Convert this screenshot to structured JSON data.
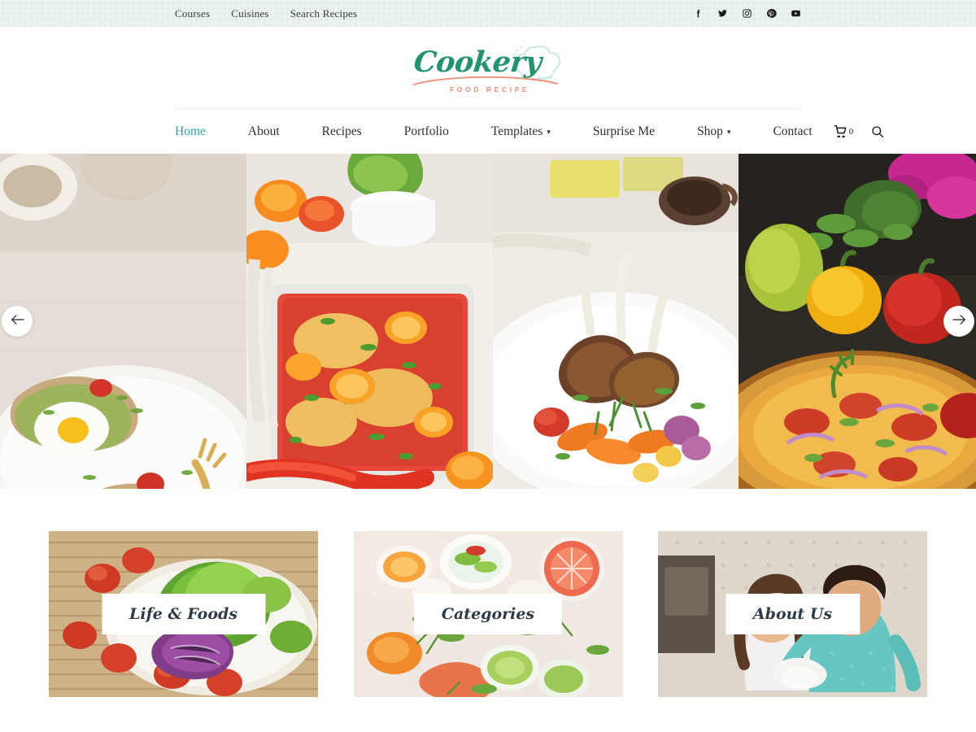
{
  "topbar": {
    "links": [
      {
        "label": "Courses",
        "name": "top-link-courses"
      },
      {
        "label": "Cuisines",
        "name": "top-link-cuisines"
      },
      {
        "label": "Search Recipes",
        "name": "top-link-search-recipes"
      }
    ],
    "socials": [
      {
        "icon": "facebook-icon",
        "label": "Facebook"
      },
      {
        "icon": "twitter-icon",
        "label": "Twitter"
      },
      {
        "icon": "instagram-icon",
        "label": "Instagram"
      },
      {
        "icon": "pinterest-icon",
        "label": "Pinterest"
      },
      {
        "icon": "youtube-icon",
        "label": "YouTube"
      }
    ],
    "background_color": "#e9f1f1"
  },
  "logo": {
    "title": "Cookery",
    "subtitle": "FOOD RECIPE",
    "title_color": "#21936e",
    "subtitle_color": "#f08a72",
    "hat_color": "#cfe6ea"
  },
  "nav": {
    "items": [
      {
        "label": "Home",
        "active": true,
        "caret": ""
      },
      {
        "label": "About",
        "active": false,
        "caret": ""
      },
      {
        "label": "Recipes",
        "active": false,
        "caret": ""
      },
      {
        "label": "Portfolio",
        "active": false,
        "caret": ""
      },
      {
        "label": "Templates",
        "active": false,
        "caret": "⌄"
      },
      {
        "label": "Surprise Me",
        "active": false,
        "caret": ""
      },
      {
        "label": "Shop",
        "active": false,
        "caret": "⌄"
      },
      {
        "label": "Contact",
        "active": false,
        "caret": ""
      }
    ],
    "active_color": "#2ba5a5",
    "cart_count": "0",
    "cart_icon": "shopping-cart-icon",
    "search_icon": "search-icon"
  },
  "slider": {
    "prev_label": "Previous slide",
    "next_label": "Next slide",
    "prev_icon": "arrow-left-icon",
    "next_icon": "arrow-right-icon",
    "slides": [
      {
        "alt": "Avocado toast with fried eggs and cherry tomatoes on a white plate"
      },
      {
        "alt": "Baked chicken with orange slices and peppers in a glass dish"
      },
      {
        "alt": "Grilled lamb chops with carrots and rosemary on a white plate"
      },
      {
        "alt": "Pizza with red onion, tomato and fresh vegetables"
      }
    ]
  },
  "cards": [
    {
      "label": "Life & Foods",
      "alt": "Fresh salad with lettuce, tomatoes and red cabbage on a bamboo mat"
    },
    {
      "label": "Categories",
      "alt": "Citrus drinks with grapefruit, lime and cucumber on ice"
    },
    {
      "label": "About Us",
      "alt": "Couple cooking together in a kitchen"
    }
  ]
}
